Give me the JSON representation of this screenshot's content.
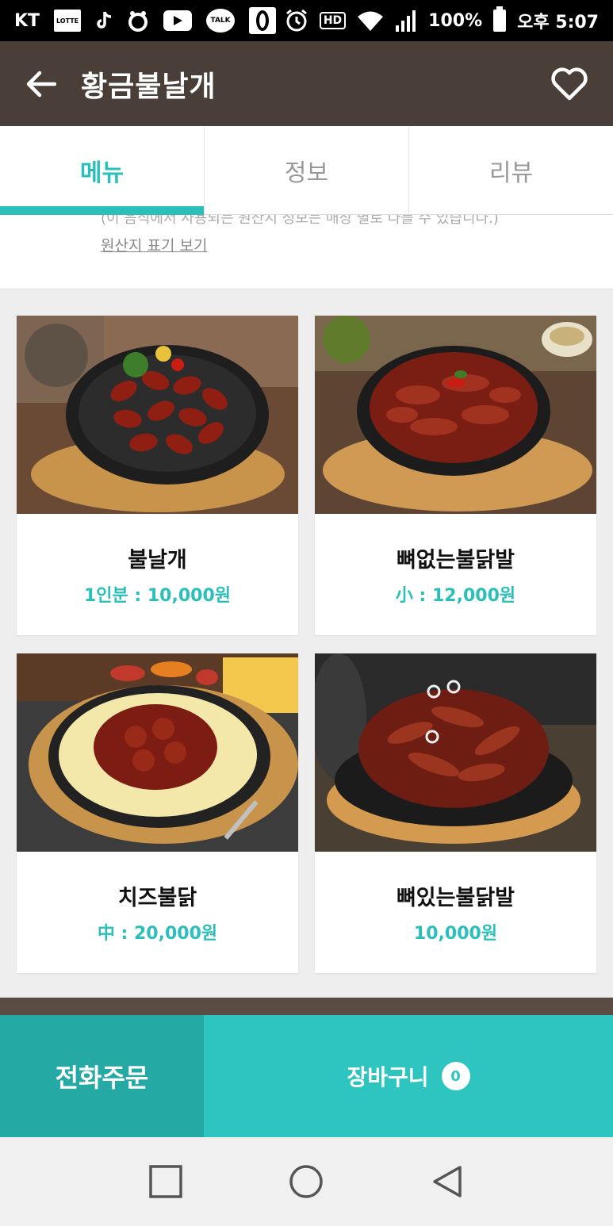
{
  "status_bar": {
    "carrier": "KT",
    "lotte_label": "LOTTE",
    "talk_label": "TALK",
    "hd_label": "HD",
    "battery": "100%",
    "time": "오후 5:07"
  },
  "header": {
    "title": "황금불날개",
    "bg_color": "#4a3e38"
  },
  "tabs": [
    {
      "label": "메뉴",
      "active": true
    },
    {
      "label": "정보",
      "active": false
    },
    {
      "label": "리뷰",
      "active": false
    }
  ],
  "origin": {
    "clipped_text": "(이 음식에서 사용되는 원산지 정보는 매장 별로 다를 수 있습니다.)",
    "link_label": "원산지 표기 보기"
  },
  "menu_items": [
    {
      "name": "불날개",
      "price": "1인분 : 10,000원"
    },
    {
      "name": "뼈없는불닭발",
      "price": "小 : 12,000원"
    },
    {
      "name": "치즈불닭",
      "price": "中 : 20,000원"
    },
    {
      "name": "뼈있는불닭발",
      "price": "10,000원"
    }
  ],
  "bottom": {
    "phone_order_label": "전화주문",
    "cart_label": "장바구니",
    "cart_count": "0"
  },
  "colors": {
    "accent": "#2bbfba",
    "accent_dark": "#25a9a5",
    "header": "#4a3e38"
  },
  "icons": {
    "back": "arrow-left-icon",
    "favorite": "heart-outline-icon",
    "nav_recent": "square-icon",
    "nav_home": "circle-icon",
    "nav_back": "triangle-back-icon"
  }
}
